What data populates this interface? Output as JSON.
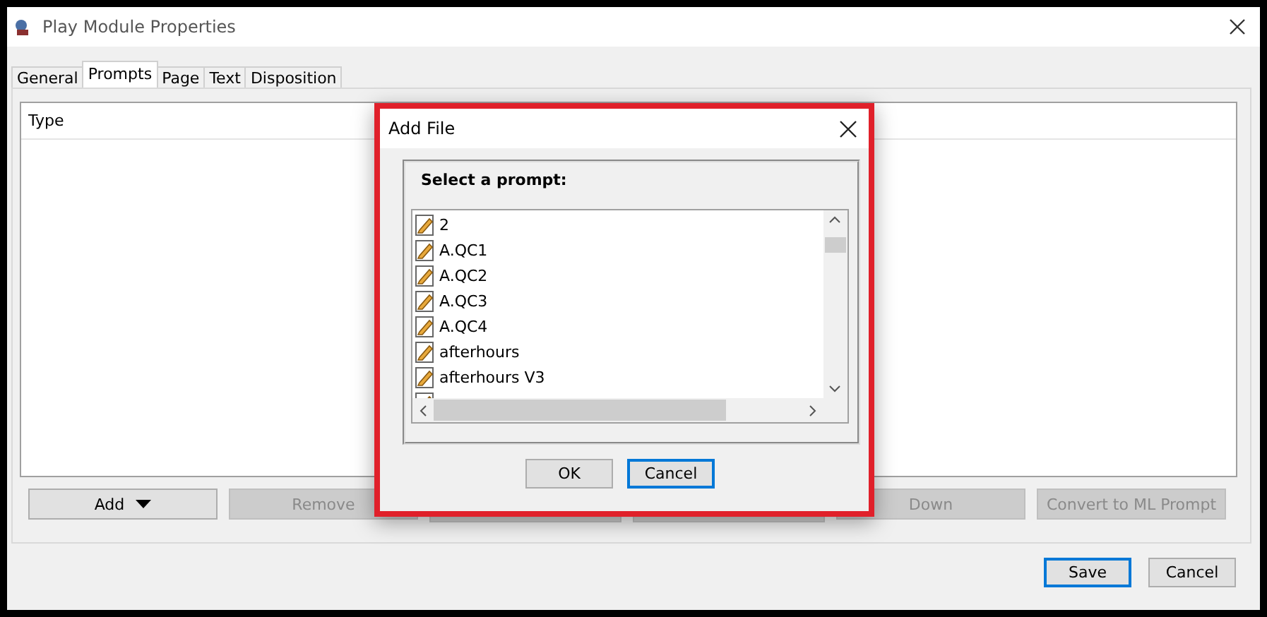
{
  "window": {
    "title": "Play Module Properties"
  },
  "tabs": [
    {
      "label": "General",
      "selected": false
    },
    {
      "label": "Prompts",
      "selected": true
    },
    {
      "label": "Page",
      "selected": false
    },
    {
      "label": "Text",
      "selected": false
    },
    {
      "label": "Disposition",
      "selected": false
    }
  ],
  "table": {
    "columns": [
      "Type"
    ]
  },
  "actions": [
    {
      "label": "Add",
      "kind": "dropdown",
      "disabled": false
    },
    {
      "label": "Remove",
      "kind": "plain",
      "disabled": true
    },
    {
      "kind": "hidden",
      "disabled": true
    },
    {
      "kind": "hidden",
      "disabled": true
    },
    {
      "label": "Down",
      "kind": "plain",
      "disabled": true
    },
    {
      "label": "Convert to ML Prompt",
      "kind": "plain",
      "disabled": true
    }
  ],
  "footer_buttons": [
    {
      "label": "Save",
      "selected": true
    },
    {
      "label": "Cancel",
      "selected": false
    }
  ],
  "dialog": {
    "title": "Add File",
    "prompt_label": "Select a prompt:",
    "items": [
      "2",
      "A.QC1",
      "A.QC2",
      "A.QC3",
      "A.QC4",
      "afterhours",
      "afterhours V3"
    ],
    "buttons": [
      {
        "label": "OK",
        "selected": false
      },
      {
        "label": "Cancel",
        "selected": true
      }
    ]
  }
}
